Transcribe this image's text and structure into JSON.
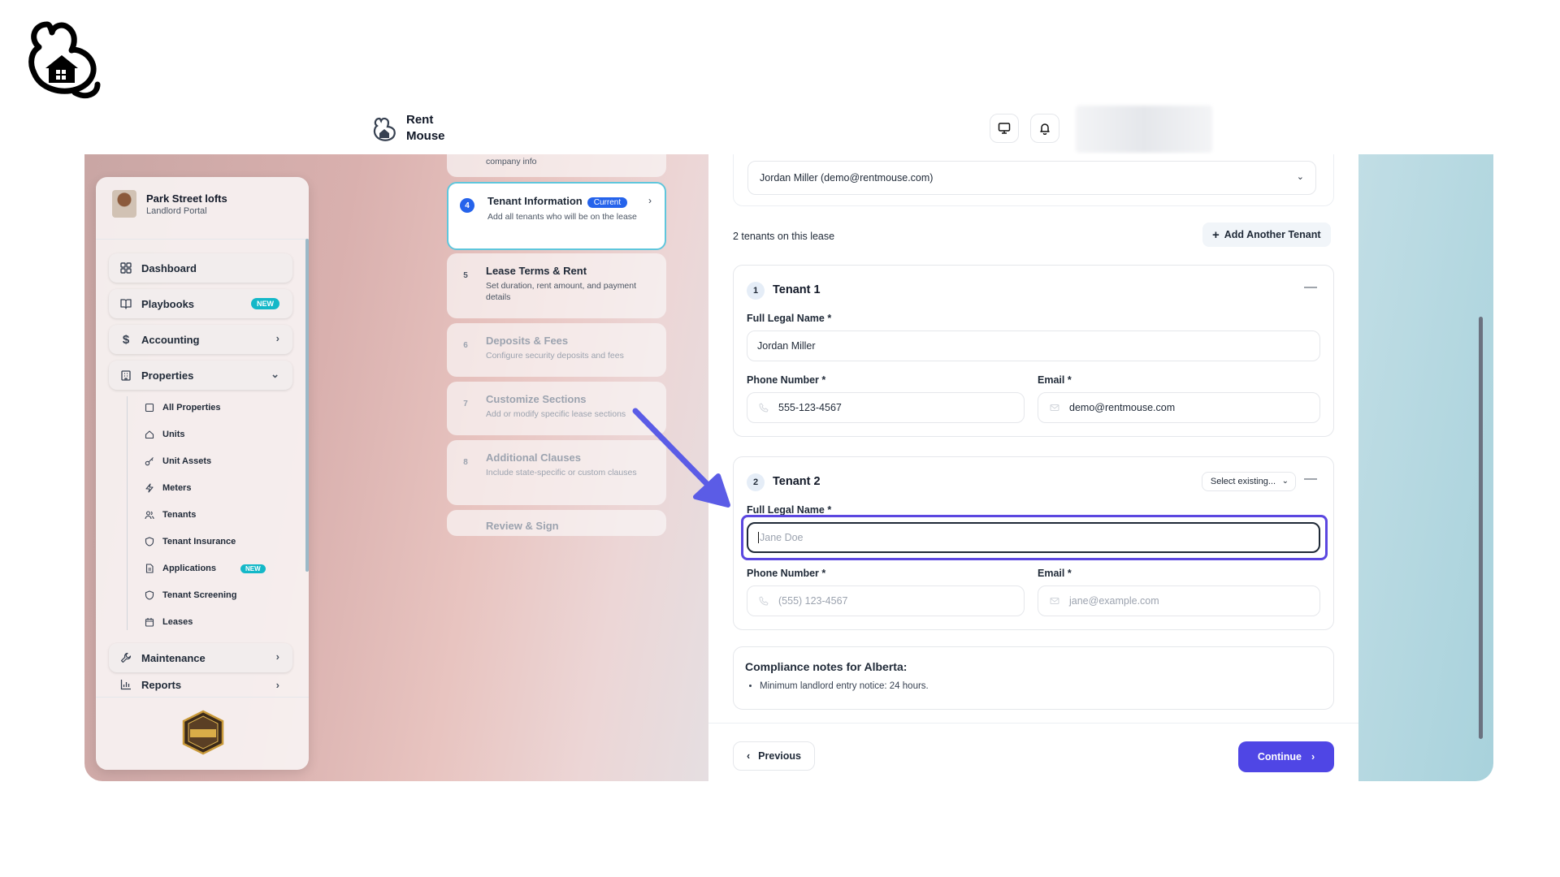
{
  "brand": {
    "name_line1": "Rent",
    "name_line2": "Mouse"
  },
  "org": {
    "name": "Park Street lofts",
    "subtitle": "Landlord Portal"
  },
  "nav": {
    "dashboard": "Dashboard",
    "playbooks": "Playbooks",
    "playbooks_badge": "NEW",
    "accounting": "Accounting",
    "properties": "Properties",
    "maintenance": "Maintenance",
    "reports": "Reports"
  },
  "properties_sub": [
    {
      "label": "All Properties",
      "icon": "building-icon"
    },
    {
      "label": "Units",
      "icon": "home-icon"
    },
    {
      "label": "Unit Assets",
      "icon": "key-icon"
    },
    {
      "label": "Meters",
      "icon": "bolt-icon"
    },
    {
      "label": "Tenants",
      "icon": "users-icon"
    },
    {
      "label": "Tenant Insurance",
      "icon": "shield-icon"
    },
    {
      "label": "Applications",
      "icon": "document-icon",
      "badge": "NEW"
    },
    {
      "label": "Tenant Screening",
      "icon": "shield-icon"
    },
    {
      "label": "Leases",
      "icon": "calendar-icon"
    }
  ],
  "steps": {
    "prev_desc": "company info",
    "s4": {
      "num": "4",
      "title": "Tenant Information",
      "badge": "Current",
      "desc": "Add all tenants who will be on the lease"
    },
    "s5": {
      "num": "5",
      "title": "Lease Terms & Rent",
      "desc": "Set duration, rent amount, and payment details"
    },
    "s6": {
      "num": "6",
      "title": "Deposits & Fees",
      "desc": "Configure security deposits and fees"
    },
    "s7": {
      "num": "7",
      "title": "Customize Sections",
      "desc": "Add or modify specific lease sections"
    },
    "s8": {
      "num": "8",
      "title": "Additional Clauses",
      "desc": "Include state-specific or custom clauses"
    },
    "s9": {
      "title": "Review & Sign"
    }
  },
  "main": {
    "account_select": "Jordan Miller (demo@rentmouse.com)",
    "tenant_count": "2 tenants on this lease",
    "add_tenant": "Add Another Tenant"
  },
  "tenant1": {
    "num": "1",
    "title": "Tenant 1",
    "name_label": "Full Legal Name *",
    "name_value": "Jordan Miller",
    "phone_label": "Phone Number *",
    "phone_value": "555-123-4567",
    "email_label": "Email *",
    "email_value": "demo@rentmouse.com"
  },
  "tenant2": {
    "num": "2",
    "title": "Tenant 2",
    "select_existing": "Select existing...",
    "name_label": "Full Legal Name *",
    "name_placeholder": "Jane Doe",
    "phone_label": "Phone Number *",
    "phone_placeholder": "(555) 123-4567",
    "email_label": "Email *",
    "email_placeholder": "jane@example.com"
  },
  "compliance": {
    "title": "Compliance notes for Alberta:",
    "item": "Minimum landlord entry notice: 24 hours."
  },
  "footer": {
    "previous": "Previous",
    "continue": "Continue"
  },
  "colors": {
    "accent": "#4f46e5",
    "focus": "#5b47e0",
    "current_border": "#5fc6dc",
    "badge_teal": "#14b8c8"
  }
}
